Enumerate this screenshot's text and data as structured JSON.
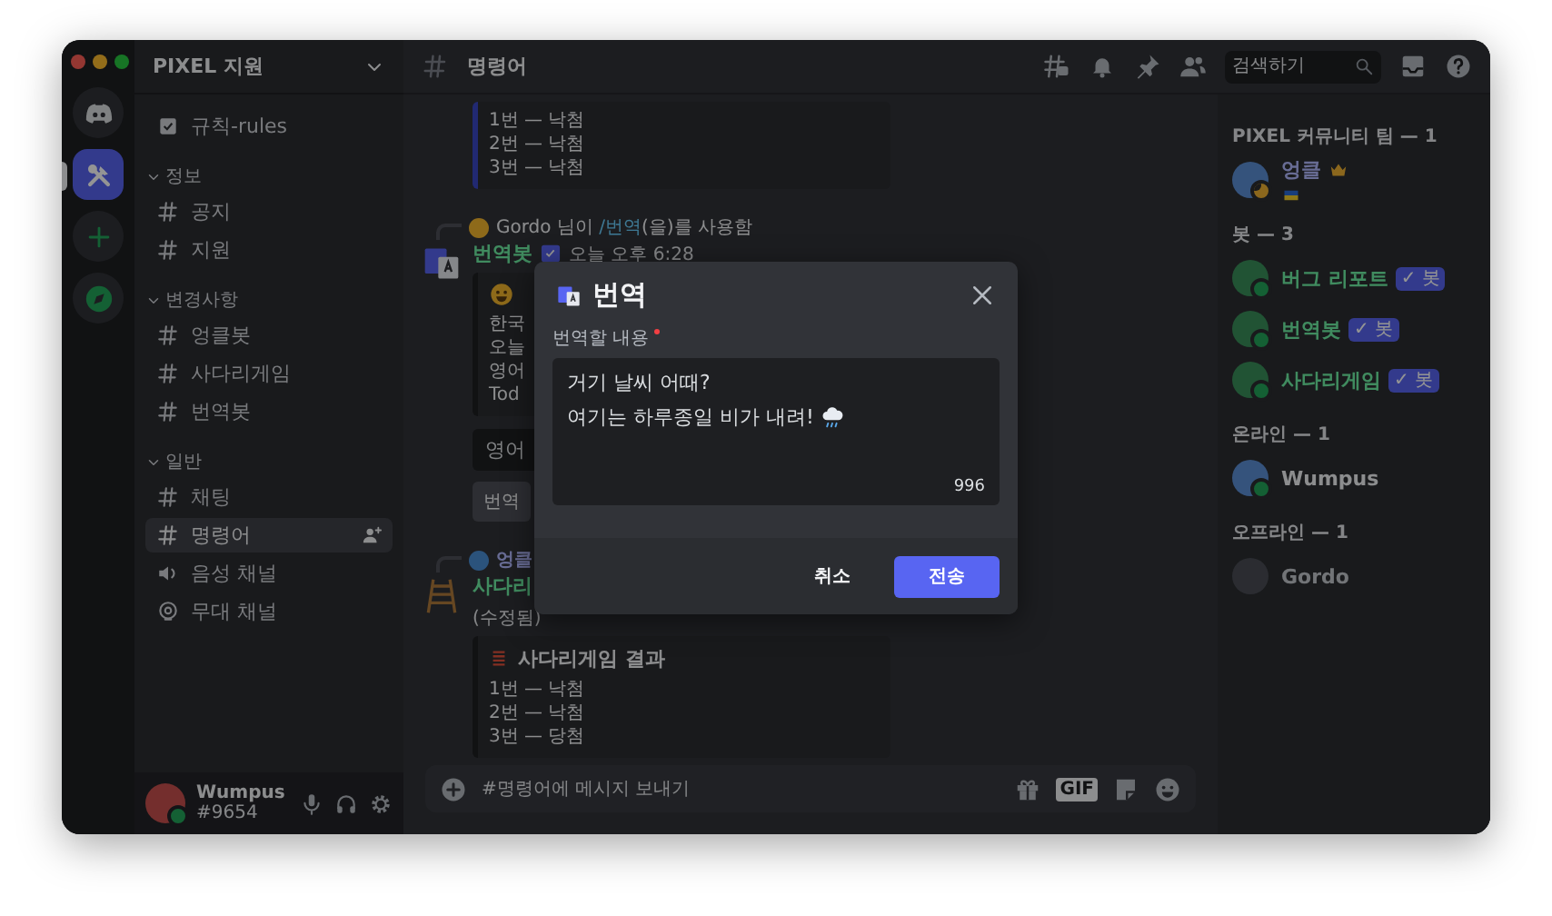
{
  "server_rail": [
    {
      "kind": "home",
      "selected": false
    },
    {
      "kind": "server",
      "selected": true
    },
    {
      "kind": "add",
      "selected": false
    },
    {
      "kind": "explore",
      "selected": false
    }
  ],
  "sidebar": {
    "server_name": "PIXEL 지원",
    "channels": [
      {
        "name": "규칙-rules",
        "kind": "rules",
        "selected": false
      }
    ],
    "categories": [
      {
        "name": "정보",
        "expanded": true,
        "channels": [
          {
            "name": "공지",
            "kind": "text",
            "selected": false
          },
          {
            "name": "지원",
            "kind": "text",
            "selected": false
          }
        ]
      },
      {
        "name": "변경사항",
        "expanded": true,
        "channels": [
          {
            "name": "엉클봇",
            "kind": "text",
            "selected": false
          },
          {
            "name": "사다리게임",
            "kind": "text",
            "selected": false
          },
          {
            "name": "번역봇",
            "kind": "text",
            "selected": false
          }
        ]
      },
      {
        "name": "일반",
        "expanded": true,
        "channels": [
          {
            "name": "채팅",
            "kind": "text",
            "selected": false
          },
          {
            "name": "명령어",
            "kind": "text",
            "selected": true
          },
          {
            "name": "음성 채널",
            "kind": "voice",
            "selected": false
          },
          {
            "name": "무대 채널",
            "kind": "stage",
            "selected": false
          }
        ]
      }
    ]
  },
  "user_panel": {
    "name": "Wumpus",
    "tag": "#9654",
    "online": true
  },
  "top_bar": {
    "channel_name": "명령어",
    "search_placeholder": "검색하기"
  },
  "messages": [
    {
      "kind": "embed_tail",
      "lines": [
        "1번 — 낙첨",
        "2번 — 낙첨",
        "3번 — 낙첨"
      ]
    },
    {
      "kind": "command_reply",
      "reply": {
        "user": "Gordo",
        "before": " 님이 ",
        "command": "/번역",
        "after": "(을)를 사용함"
      },
      "author": "번역봇",
      "timestamp": "오늘 오후 6:28",
      "embed": {
        "lines": [
          "한국",
          "오늘",
          "영어",
          "Tod"
        ]
      },
      "select_value": "영어",
      "button": "번역"
    },
    {
      "kind": "edited_reply",
      "reply": {
        "user": "엉클"
      },
      "author": "사다리",
      "edited": "(수정됨)",
      "embed": {
        "title": "사다리게임 결과",
        "lines": [
          "1번 — 낙첨",
          "2번 — 낙첨",
          "3번 — 당첨"
        ]
      }
    }
  ],
  "message_input": {
    "placeholder": "#명령어에 메시지 보내기",
    "gif_label": "GIF"
  },
  "member_groups": [
    {
      "title": "PIXEL 커뮤니티 팀 — 1",
      "members": [
        {
          "name": "엉클",
          "kind": "staff",
          "online": true,
          "idle": true,
          "crown": true,
          "custom_status": true
        }
      ]
    },
    {
      "title": "봇 — 3",
      "members": [
        {
          "name": "버그 리포트",
          "kind": "bot",
          "online": true,
          "idle": false,
          "badge": "✓ 봇"
        },
        {
          "name": "번역봇",
          "kind": "bot",
          "online": true,
          "idle": false,
          "badge": "✓ 봇"
        },
        {
          "name": "사다리게임",
          "kind": "bot",
          "online": true,
          "idle": false,
          "badge": "✓ 봇"
        }
      ]
    },
    {
      "title": "온라인 — 1",
      "members": [
        {
          "name": "Wumpus",
          "kind": "member",
          "online": true,
          "idle": false
        }
      ]
    },
    {
      "title": "오프라인 — 1",
      "members": [
        {
          "name": "Gordo",
          "kind": "member",
          "online": false,
          "idle": false
        }
      ]
    }
  ],
  "modal": {
    "title": "번역",
    "field_label": "번역할 내용",
    "required": true,
    "value_lines": [
      "거기 날씨 어때?",
      "여기는 하루종일 비가 내려!"
    ],
    "counter": "996",
    "cancel": "취소",
    "submit": "전송"
  }
}
